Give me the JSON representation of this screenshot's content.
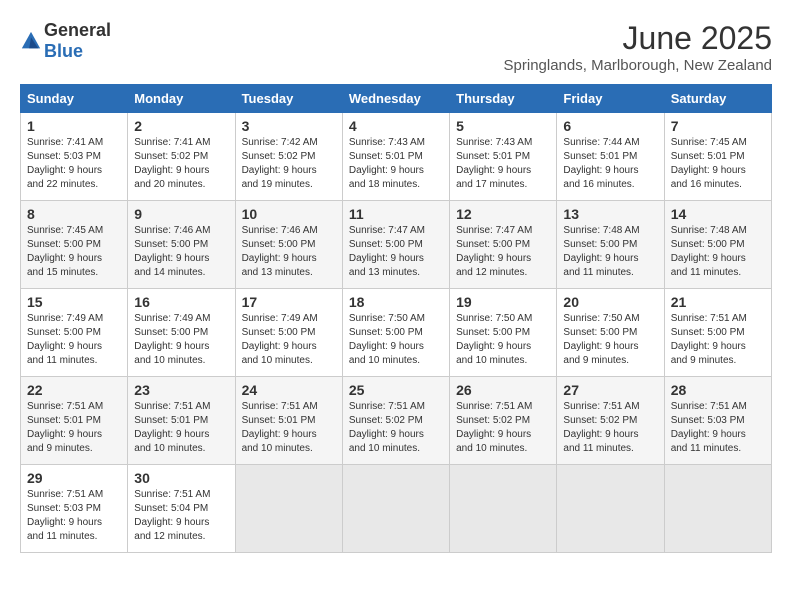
{
  "logo": {
    "general": "General",
    "blue": "Blue"
  },
  "title": "June 2025",
  "subtitle": "Springlands, Marlborough, New Zealand",
  "headers": [
    "Sunday",
    "Monday",
    "Tuesday",
    "Wednesday",
    "Thursday",
    "Friday",
    "Saturday"
  ],
  "weeks": [
    [
      {
        "day": "1",
        "sunrise": "7:41 AM",
        "sunset": "5:03 PM",
        "daylight": "9 hours and 22 minutes."
      },
      {
        "day": "2",
        "sunrise": "7:41 AM",
        "sunset": "5:02 PM",
        "daylight": "9 hours and 20 minutes."
      },
      {
        "day": "3",
        "sunrise": "7:42 AM",
        "sunset": "5:02 PM",
        "daylight": "9 hours and 19 minutes."
      },
      {
        "day": "4",
        "sunrise": "7:43 AM",
        "sunset": "5:01 PM",
        "daylight": "9 hours and 18 minutes."
      },
      {
        "day": "5",
        "sunrise": "7:43 AM",
        "sunset": "5:01 PM",
        "daylight": "9 hours and 17 minutes."
      },
      {
        "day": "6",
        "sunrise": "7:44 AM",
        "sunset": "5:01 PM",
        "daylight": "9 hours and 16 minutes."
      },
      {
        "day": "7",
        "sunrise": "7:45 AM",
        "sunset": "5:01 PM",
        "daylight": "9 hours and 16 minutes."
      }
    ],
    [
      {
        "day": "8",
        "sunrise": "7:45 AM",
        "sunset": "5:00 PM",
        "daylight": "9 hours and 15 minutes."
      },
      {
        "day": "9",
        "sunrise": "7:46 AM",
        "sunset": "5:00 PM",
        "daylight": "9 hours and 14 minutes."
      },
      {
        "day": "10",
        "sunrise": "7:46 AM",
        "sunset": "5:00 PM",
        "daylight": "9 hours and 13 minutes."
      },
      {
        "day": "11",
        "sunrise": "7:47 AM",
        "sunset": "5:00 PM",
        "daylight": "9 hours and 13 minutes."
      },
      {
        "day": "12",
        "sunrise": "7:47 AM",
        "sunset": "5:00 PM",
        "daylight": "9 hours and 12 minutes."
      },
      {
        "day": "13",
        "sunrise": "7:48 AM",
        "sunset": "5:00 PM",
        "daylight": "9 hours and 11 minutes."
      },
      {
        "day": "14",
        "sunrise": "7:48 AM",
        "sunset": "5:00 PM",
        "daylight": "9 hours and 11 minutes."
      }
    ],
    [
      {
        "day": "15",
        "sunrise": "7:49 AM",
        "sunset": "5:00 PM",
        "daylight": "9 hours and 11 minutes."
      },
      {
        "day": "16",
        "sunrise": "7:49 AM",
        "sunset": "5:00 PM",
        "daylight": "9 hours and 10 minutes."
      },
      {
        "day": "17",
        "sunrise": "7:49 AM",
        "sunset": "5:00 PM",
        "daylight": "9 hours and 10 minutes."
      },
      {
        "day": "18",
        "sunrise": "7:50 AM",
        "sunset": "5:00 PM",
        "daylight": "9 hours and 10 minutes."
      },
      {
        "day": "19",
        "sunrise": "7:50 AM",
        "sunset": "5:00 PM",
        "daylight": "9 hours and 10 minutes."
      },
      {
        "day": "20",
        "sunrise": "7:50 AM",
        "sunset": "5:00 PM",
        "daylight": "9 hours and 9 minutes."
      },
      {
        "day": "21",
        "sunrise": "7:51 AM",
        "sunset": "5:00 PM",
        "daylight": "9 hours and 9 minutes."
      }
    ],
    [
      {
        "day": "22",
        "sunrise": "7:51 AM",
        "sunset": "5:01 PM",
        "daylight": "9 hours and 9 minutes."
      },
      {
        "day": "23",
        "sunrise": "7:51 AM",
        "sunset": "5:01 PM",
        "daylight": "9 hours and 10 minutes."
      },
      {
        "day": "24",
        "sunrise": "7:51 AM",
        "sunset": "5:01 PM",
        "daylight": "9 hours and 10 minutes."
      },
      {
        "day": "25",
        "sunrise": "7:51 AM",
        "sunset": "5:02 PM",
        "daylight": "9 hours and 10 minutes."
      },
      {
        "day": "26",
        "sunrise": "7:51 AM",
        "sunset": "5:02 PM",
        "daylight": "9 hours and 10 minutes."
      },
      {
        "day": "27",
        "sunrise": "7:51 AM",
        "sunset": "5:02 PM",
        "daylight": "9 hours and 11 minutes."
      },
      {
        "day": "28",
        "sunrise": "7:51 AM",
        "sunset": "5:03 PM",
        "daylight": "9 hours and 11 minutes."
      }
    ],
    [
      {
        "day": "29",
        "sunrise": "7:51 AM",
        "sunset": "5:03 PM",
        "daylight": "9 hours and 11 minutes."
      },
      {
        "day": "30",
        "sunrise": "7:51 AM",
        "sunset": "5:04 PM",
        "daylight": "9 hours and 12 minutes."
      },
      null,
      null,
      null,
      null,
      null
    ]
  ],
  "labels": {
    "sunrise": "Sunrise: ",
    "sunset": "Sunset: ",
    "daylight": "Daylight: "
  }
}
